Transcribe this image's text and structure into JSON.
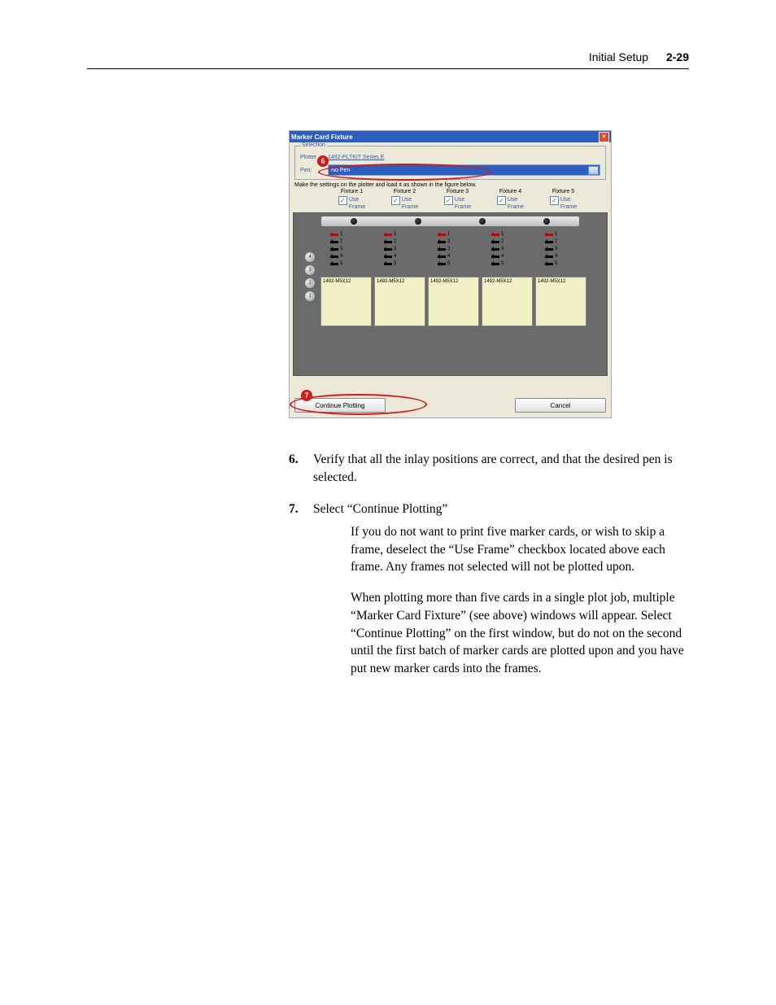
{
  "header": {
    "section": "Initial Setup",
    "page": "2-29"
  },
  "dialog": {
    "title": "Marker Card Fixture",
    "selection_legend": "Selection",
    "plotter_label": "Plotter",
    "plotter_value": "1492-PLTKIT Series E",
    "pen_label": "Pen:",
    "pen_value": "No Pen",
    "instruction": "Make the settings on the plotter and load it as shown in the figure below.",
    "fixtures": [
      "Fixture 1",
      "Fixture 2",
      "Fixture 3",
      "Fixture 4",
      "Fixture 5"
    ],
    "use_frame_label": "Use\nFrame",
    "card_label": "1492-M5X12",
    "slot_numbers": [
      "4",
      "3",
      "2",
      "1"
    ],
    "marker_ticks": [
      "1",
      "2",
      "3",
      "4",
      "5"
    ],
    "continue_btn": "Continue Plotting",
    "cancel_btn": "Cancel",
    "callout6": "6",
    "callout7": "7"
  },
  "steps": {
    "s6_num": "6.",
    "s6_text": "Verify that all the inlay positions are correct, and that the desired pen is selected.",
    "s7_num": "7.",
    "s7_text": "Select “Continue Plotting”",
    "p1": "If you do not want to print five marker cards, or wish to skip a frame, deselect the “Use Frame” checkbox located above each frame. Any frames not selected will not be plotted upon.",
    "p2": " When plotting more than five cards in a single plot job, multiple “Marker Card Fixture” (see above) windows will appear. Select “Continue Plotting” on the first window, but do not on the second until the first batch of marker cards are plotted upon and you have put new marker cards into the frames."
  }
}
